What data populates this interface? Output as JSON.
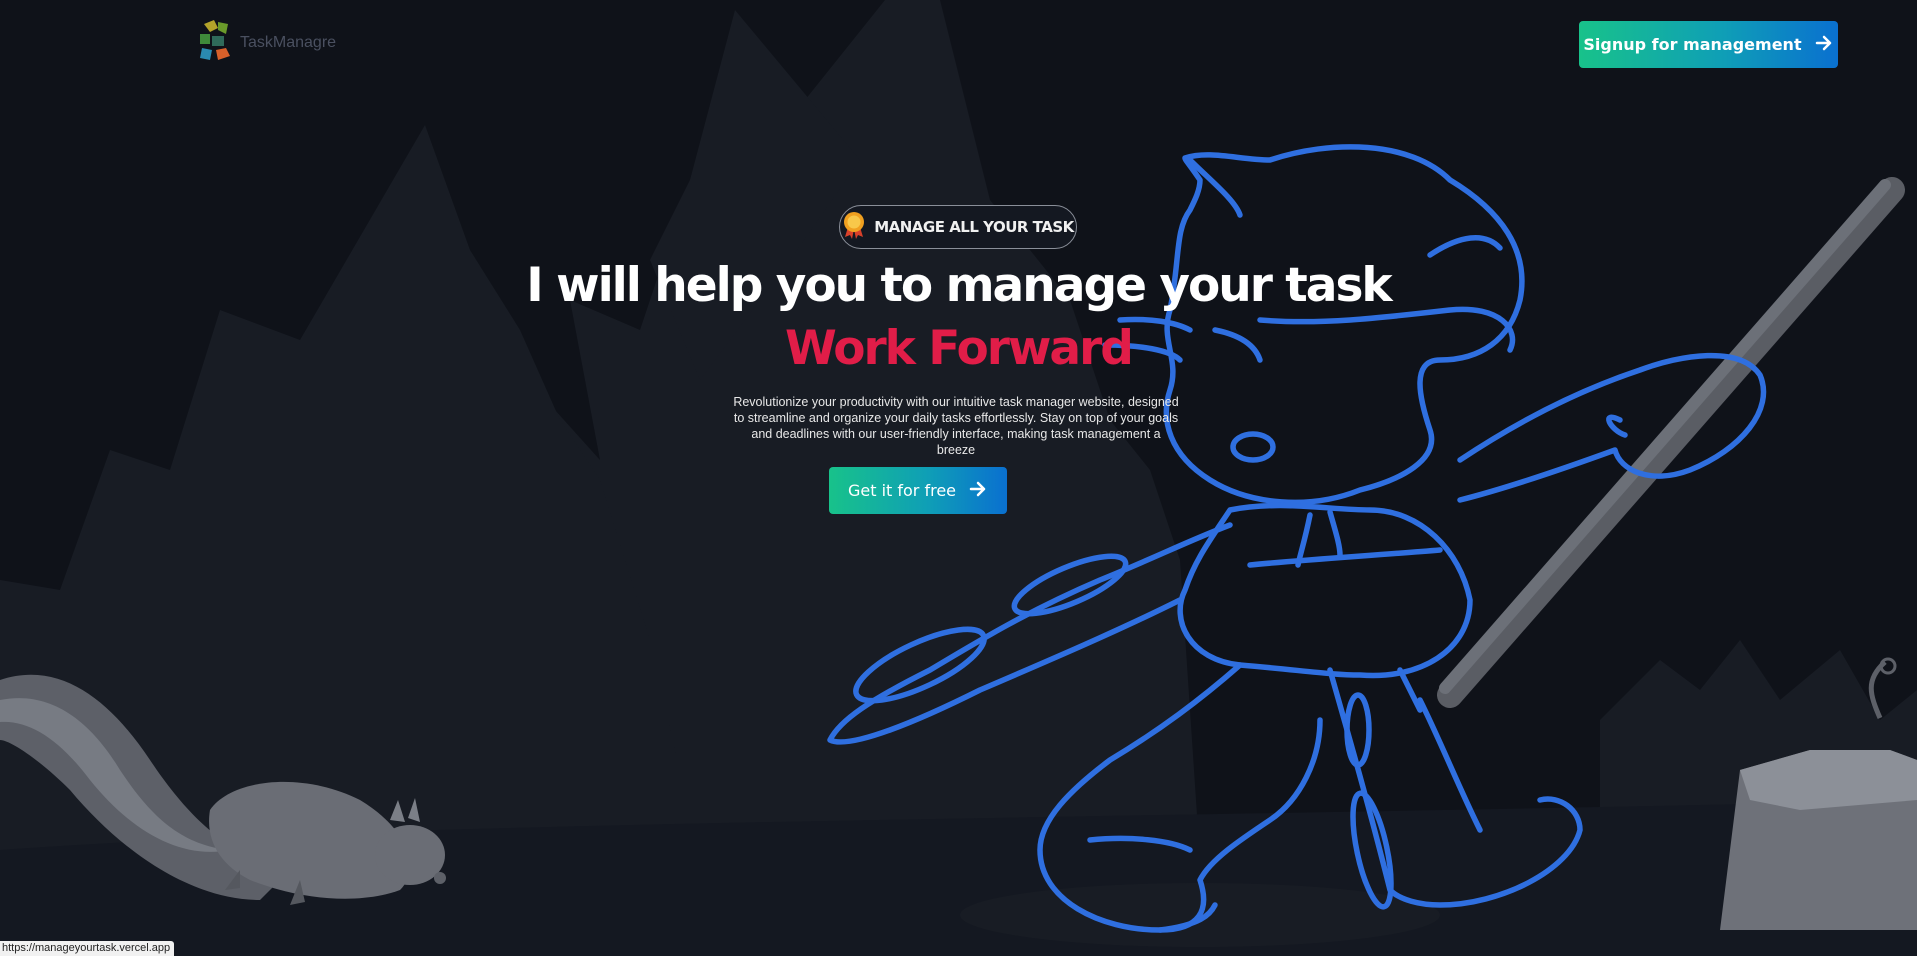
{
  "header": {
    "logo_text": "TaskManagre",
    "signup_label": "Signup for management"
  },
  "hero": {
    "badge_text": "MANAGE ALL YOUR TASK",
    "headline": "I will help you to manage your task",
    "subheadline": "Work Forward",
    "description": "Revolutionize your productivity with our intuitive task manager website, designed to streamline and organize your daily tasks effortlessly. Stay on top of your goals and deadlines with our user-friendly interface, making task management a breeze",
    "cta_label": "Get it for free"
  },
  "status_bar": {
    "url": "https://manageyourtask.vercel.app"
  },
  "icons": {
    "logo": "puzzle-logo-icon",
    "badge": "award-medal-icon",
    "arrow": "arrow-right-icon"
  },
  "colors": {
    "background": "#0f1219",
    "accent_red": "#e11d48",
    "button_gradient_start": "#18c28a",
    "button_gradient_end": "#0a70d0",
    "outline_blue": "#2f6fe0"
  }
}
